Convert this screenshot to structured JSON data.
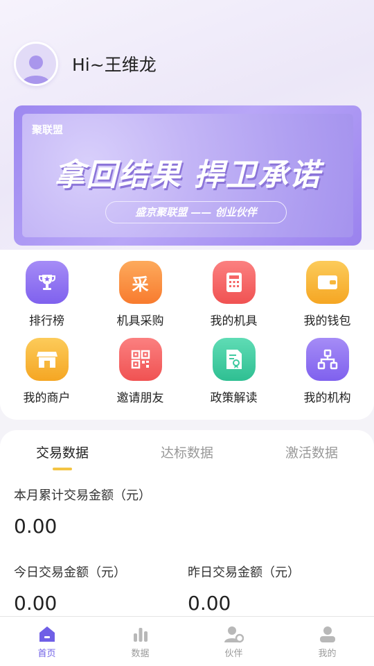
{
  "header": {
    "greeting": "Hi~王维龙"
  },
  "banner": {
    "brand": "聚联盟",
    "slogan": "拿回结果  捍卫承诺",
    "subtitle": "盛京聚联盟 —— 创业伙伴"
  },
  "menu": [
    {
      "label": "排行榜",
      "icon": "trophy-icon",
      "color": "#8b6cf0"
    },
    {
      "label": "机具采购",
      "icon": "purchase-icon",
      "color": "#f98a3e"
    },
    {
      "label": "我的机具",
      "icon": "calculator-icon",
      "color": "#f56565"
    },
    {
      "label": "我的钱包",
      "icon": "wallet-icon",
      "color": "#f6b73c"
    },
    {
      "label": "我的商户",
      "icon": "store-icon",
      "color": "#f6b73c"
    },
    {
      "label": "邀请朋友",
      "icon": "qrcode-icon",
      "color": "#f56565"
    },
    {
      "label": "政策解读",
      "icon": "policy-document-icon",
      "color": "#3fc9a0"
    },
    {
      "label": "我的机构",
      "icon": "org-chart-icon",
      "color": "#8b6cf0"
    }
  ],
  "tabs": {
    "t1": "交易数据",
    "t2": "达标数据",
    "t3": "激活数据",
    "active": "交易数据"
  },
  "stats": {
    "month_label": "本月累计交易金额（元）",
    "month_value": "0.00",
    "today_label": "今日交易金额（元）",
    "today_value": "0.00",
    "yesterday_label": "昨日交易金额（元）",
    "yesterday_value": "0.00"
  },
  "tabbar": {
    "home": "首页",
    "data": "数据",
    "partner": "伙伴",
    "mine": "我的",
    "active": "首页"
  },
  "colors": {
    "accent": "#6f5fe6",
    "tab_indicator": "#f4c443"
  }
}
